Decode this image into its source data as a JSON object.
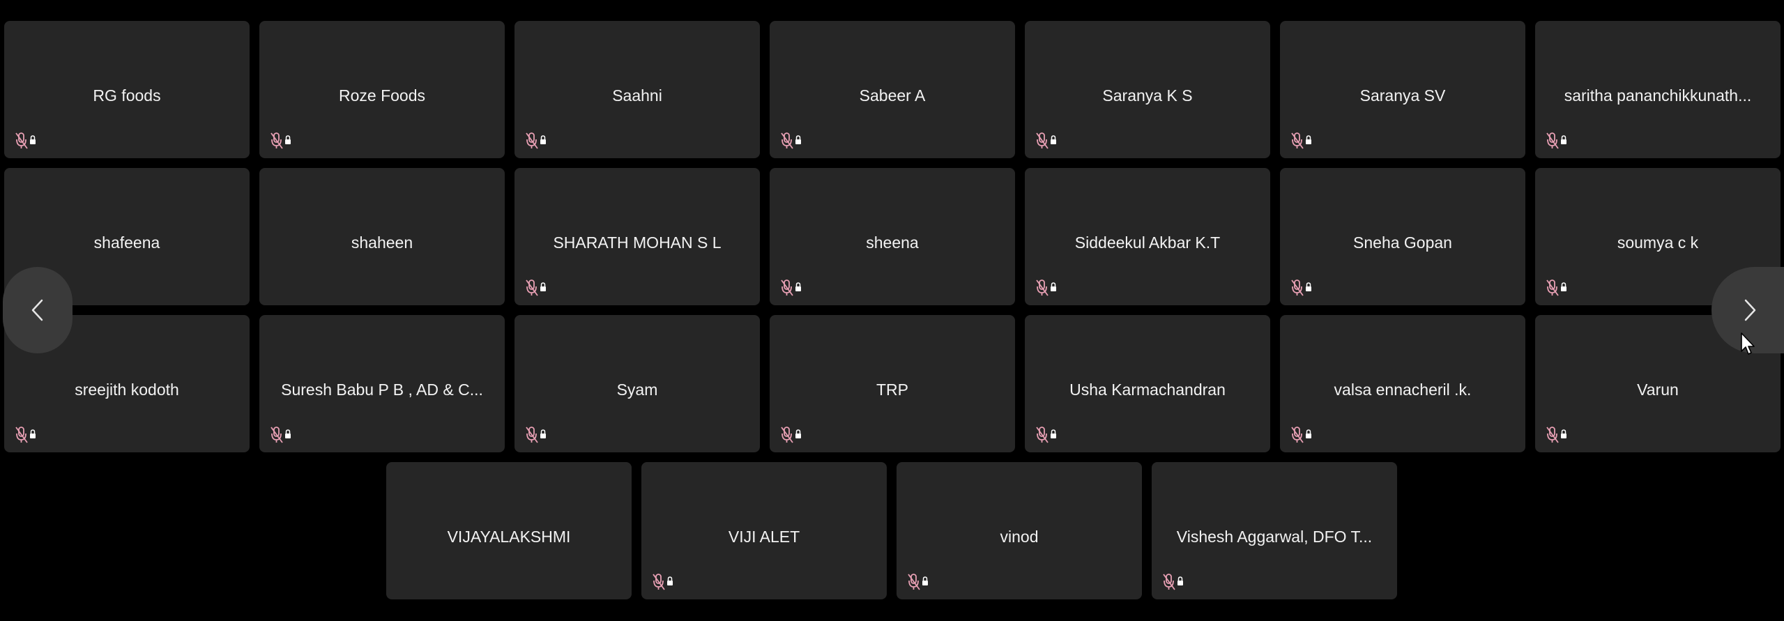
{
  "participants": [
    {
      "name": "RG foods",
      "muted": true
    },
    {
      "name": "Roze Foods",
      "muted": true
    },
    {
      "name": "Saahni",
      "muted": true
    },
    {
      "name": "Sabeer A",
      "muted": true
    },
    {
      "name": "Saranya K S",
      "muted": true
    },
    {
      "name": "Saranya SV",
      "muted": true
    },
    {
      "name": "saritha pananchikkunath...",
      "muted": true
    },
    {
      "name": "shafeena",
      "muted": false
    },
    {
      "name": "shaheen",
      "muted": false
    },
    {
      "name": "SHARATH MOHAN S L",
      "muted": true
    },
    {
      "name": "sheena",
      "muted": true
    },
    {
      "name": "Siddeekul Akbar K.T",
      "muted": true
    },
    {
      "name": "Sneha Gopan",
      "muted": true
    },
    {
      "name": "soumya c k",
      "muted": true
    },
    {
      "name": "sreejith kodoth",
      "muted": true
    },
    {
      "name": "Suresh Babu P B , AD & C...",
      "muted": true
    },
    {
      "name": "Syam",
      "muted": true
    },
    {
      "name": "TRP",
      "muted": true
    },
    {
      "name": "Usha Karmachandran",
      "muted": true
    },
    {
      "name": "valsa ennacheril .k.",
      "muted": true
    },
    {
      "name": "Varun",
      "muted": true
    },
    {
      "name": "VIJAYALAKSHMI",
      "muted": false
    },
    {
      "name": "VIJI ALET",
      "muted": true
    },
    {
      "name": "vinod",
      "muted": true
    },
    {
      "name": "Vishesh Aggarwal, DFO T...",
      "muted": true
    }
  ],
  "navigation": {
    "prev_icon": "chevron-left-icon",
    "next_icon": "chevron-right-icon"
  },
  "colors": {
    "background": "#000000",
    "tile": "#262626",
    "name_text": "#f2f2f2",
    "mic_muted": "#e8a0b4",
    "nav_button": "#3a3a3a"
  }
}
